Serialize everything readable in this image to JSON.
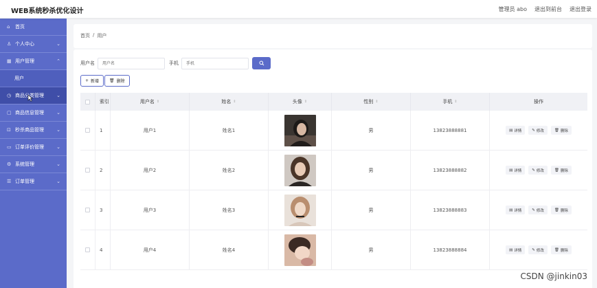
{
  "app": {
    "title": "WEB系统秒杀优化设计"
  },
  "header_links": {
    "admin": "管理员 abo",
    "front": "退出到前台",
    "logout": "退出登录"
  },
  "sidebar": {
    "items": [
      {
        "label": "首页",
        "icon": "home-icon",
        "chev": ""
      },
      {
        "label": "个人中心",
        "icon": "person-icon",
        "chev": "⌄"
      },
      {
        "label": "用户管理",
        "icon": "grid-icon",
        "chev": "⌃"
      },
      {
        "label": "用户",
        "icon": "",
        "chev": ""
      },
      {
        "label": "商品分类管理",
        "icon": "clock-icon",
        "chev": "⌄"
      },
      {
        "label": "商品信息管理",
        "icon": "box-icon",
        "chev": "⌄"
      },
      {
        "label": "秒杀商品管理",
        "icon": "lock-icon",
        "chev": "⌄"
      },
      {
        "label": "订单评价管理",
        "icon": "doc-icon",
        "chev": "⌄"
      },
      {
        "label": "系统管理",
        "icon": "gear-icon",
        "chev": "⌄"
      },
      {
        "label": "订单管理",
        "icon": "list-icon",
        "chev": "⌄"
      }
    ]
  },
  "breadcrumb": {
    "home": "首页",
    "sep": "/",
    "current": "用户"
  },
  "search": {
    "username_label": "用户名",
    "username_placeholder": "用户名",
    "phone_label": "手机",
    "phone_placeholder": "手机",
    "button_icon": "search-icon"
  },
  "actions": {
    "add": "新增",
    "add_icon": "+",
    "delete": "删除",
    "delete_icon": "🗑"
  },
  "table": {
    "columns": {
      "index": "索引",
      "username": "用户名",
      "name": "姓名",
      "avatar": "头像",
      "sex": "性别",
      "phone": "手机",
      "ops": "操作"
    },
    "sort_glyph": "⇕",
    "rows": [
      {
        "index": "1",
        "username": "用户1",
        "name": "姓名1",
        "sex": "男",
        "phone": "13823888881"
      },
      {
        "index": "2",
        "username": "用户2",
        "name": "姓名2",
        "sex": "男",
        "phone": "13823888882"
      },
      {
        "index": "3",
        "username": "用户3",
        "name": "姓名3",
        "sex": "男",
        "phone": "13823888883"
      },
      {
        "index": "4",
        "username": "用户4",
        "name": "姓名4",
        "sex": "男",
        "phone": "13823888884"
      }
    ],
    "op_labels": {
      "detail": "详情",
      "edit": "修改",
      "delete": "删除"
    }
  },
  "watermark": "CSDN @jinkin03",
  "colors": {
    "accent": "#5b6bc9",
    "sidebar_active": "#3f4ea8"
  }
}
